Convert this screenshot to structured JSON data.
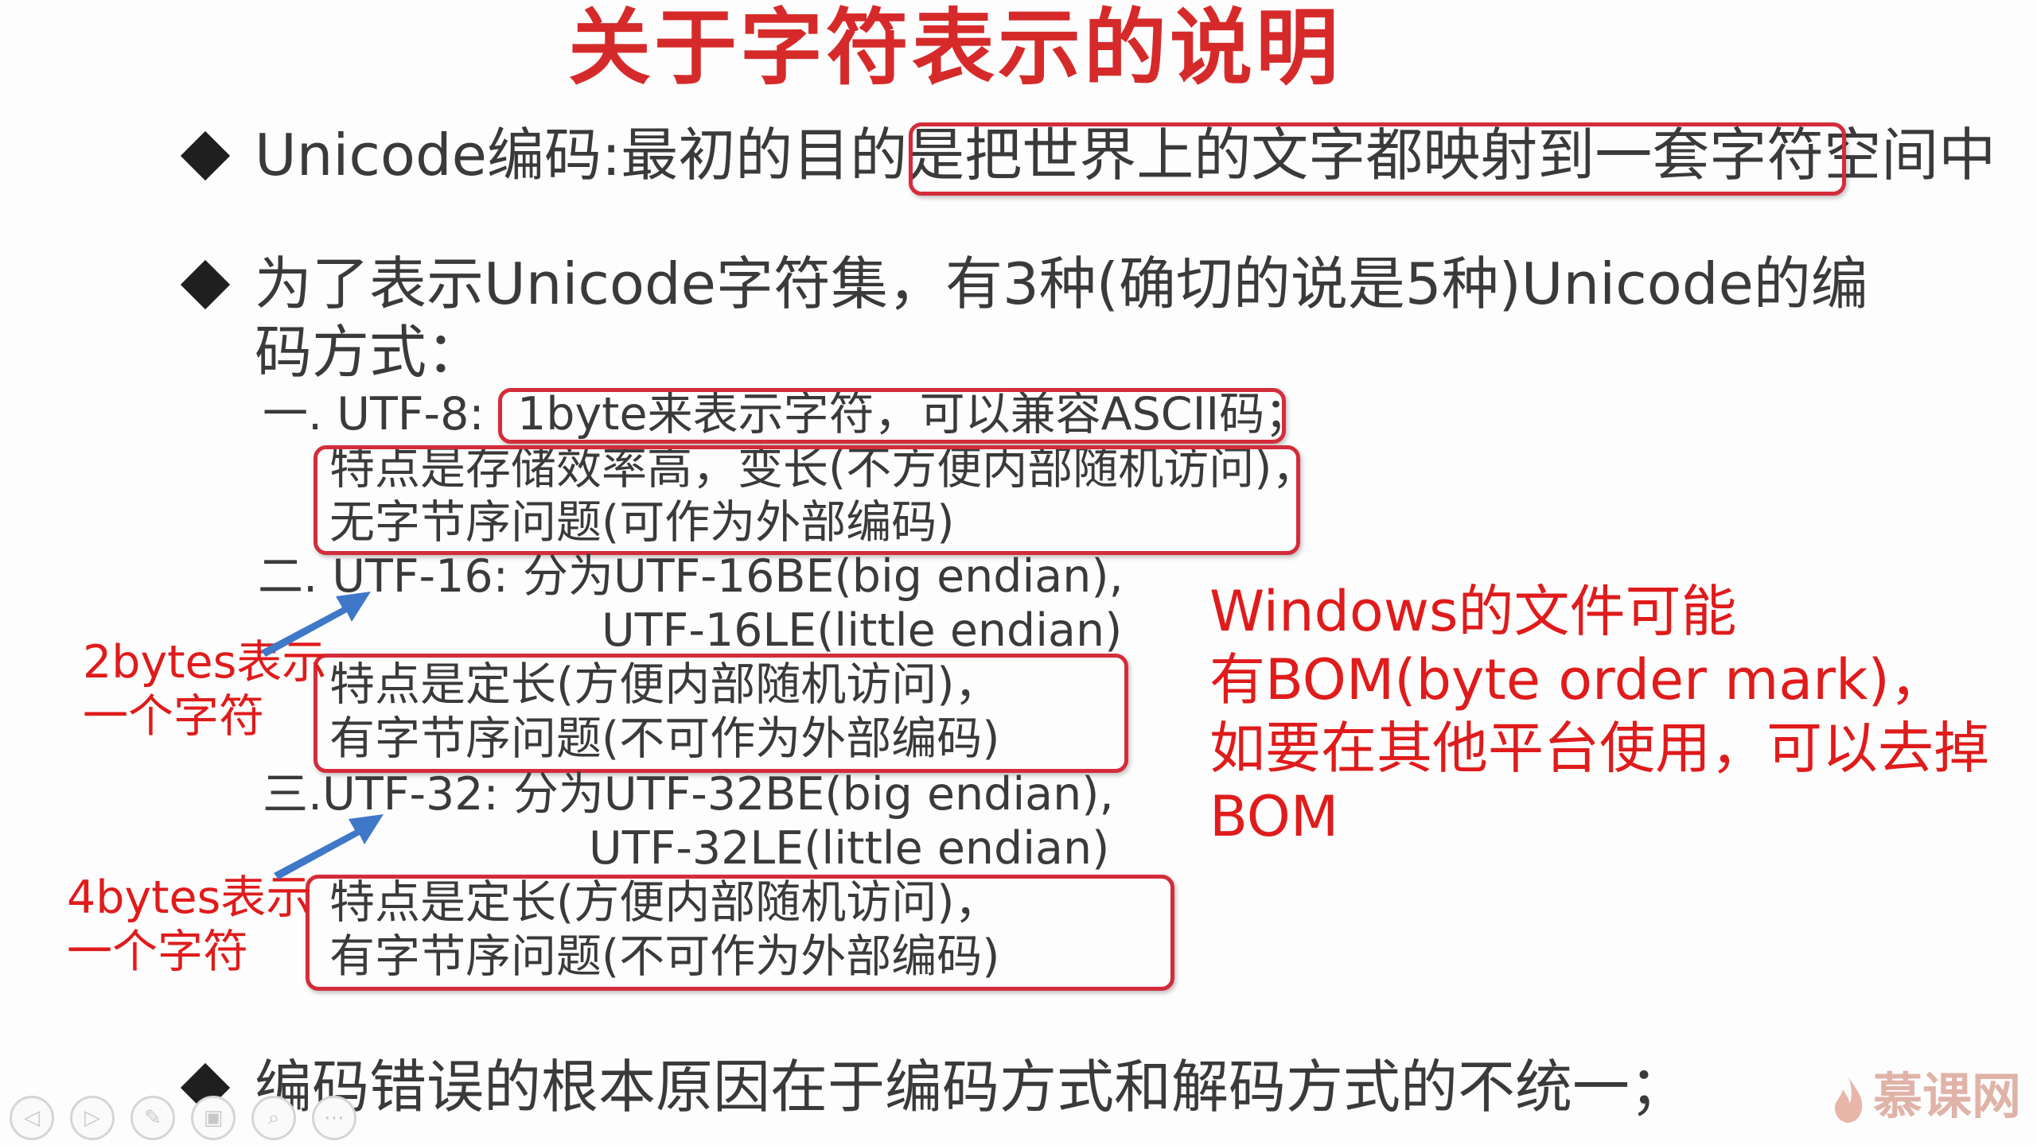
{
  "title": "关于字符表示的说明",
  "bullets": [
    {
      "prefix": "Unicode编码:最初的目的是",
      "boxed": "把世界上的文字都映射到一套字符空间中"
    },
    {
      "line1": "为了表示Unicode字符集，有3种(确切的说是5种)Unicode的编",
      "line2": "码方式："
    },
    {
      "text": "编码错误的根本原因在于编码方式和解码方式的不统一；"
    }
  ],
  "utf8": {
    "label": "一. UTF-8:",
    "boxed": "1byte来表示字符，可以兼容ASCII码；",
    "note1": "特点是存储效率高，变长(不方便内部随机访问)，",
    "note2": "无字节序问题(可作为外部编码)"
  },
  "utf16": {
    "label": "二. UTF-16: 分为UTF-16BE(big endian),",
    "label2": "UTF-16LE(little endian)",
    "note1": "特点是定长(方便内部随机访问)，",
    "note2": "有字节序问题(不可作为外部编码)",
    "side1": "2bytes表示",
    "side2": "一个字符"
  },
  "utf32": {
    "label": "三.UTF-32: 分为UTF-32BE(big endian),",
    "label2": "UTF-32LE(little endian)",
    "note1": "特点是定长(方便内部随机访问)，",
    "note2": "有字节序问题(不可作为外部编码)",
    "side1": "4bytes表示",
    "side2": "一个字符"
  },
  "bom_note": [
    "Windows的文件可能",
    "有BOM(byte order mark)，",
    "如要在其他平台使用，可以去掉",
    "BOM"
  ],
  "logo": "慕课网",
  "colors": {
    "title": "#d62a2a",
    "annotation": "#e01b1b",
    "box_border": "#d42c3a",
    "arrow": "#3f77c9"
  },
  "controls": [
    {
      "icon": "back-icon",
      "glyph": "◁"
    },
    {
      "icon": "forward-icon",
      "glyph": "▷"
    },
    {
      "icon": "pen-icon",
      "glyph": "✎"
    },
    {
      "icon": "slides-icon",
      "glyph": "▣"
    },
    {
      "icon": "zoom-icon",
      "glyph": "⌕"
    },
    {
      "icon": "more-icon",
      "glyph": "⋯"
    }
  ]
}
